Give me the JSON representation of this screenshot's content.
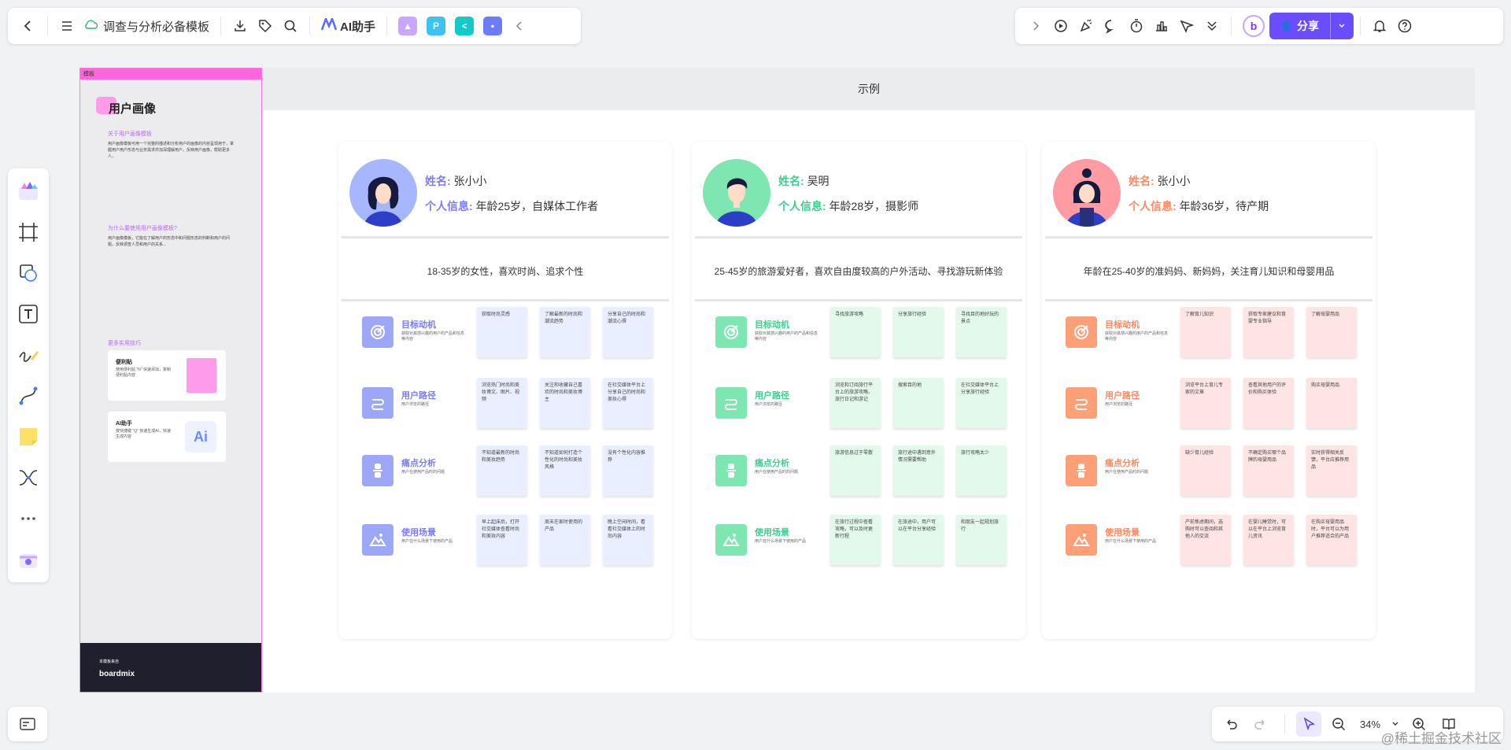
{
  "toolbar": {
    "doc_title": "调查与分析必备模板",
    "ai_label": "AI助手",
    "share_label": "分享",
    "zoom": "34%"
  },
  "template": {
    "header": "模板",
    "title": "用户画像",
    "sec1_head": "关于用户画像模板",
    "sec1_text": "用户画像模板可用一个完整的描述和分析用户的画像的内容呈现用于，掌握用户用户形态与业务需求并加深理解用户，反映用户画像，帮助更多人，",
    "sec2_head": "为什么要使用用户画像模板?",
    "sec2_text": "用户画像模板，它能在了解用户的形态中和问题形态的判断和用户的问题，反映调查人员和用户的关系...",
    "sec3_head": "更多实用技巧",
    "card1_title": "便利贴",
    "card1_text": "使用便利贴 \"N\" 快速添加，复制便利贴内容",
    "card2_title": "AI助手",
    "card2_text": "按快捷键 \"Q\" 快速生成AI，快速生成内容",
    "footer_small": "本模板来自",
    "footer_brand": "boardmix"
  },
  "main": {
    "header": "示例",
    "name_key": "姓名:",
    "info_key": "个人信息:",
    "personas": [
      {
        "name": "张小小",
        "info": "年龄25岁，自媒体工作者",
        "desc": "18-35岁的女性，喜欢时尚、追求个性",
        "accent": "#7b7cf6",
        "sticky": "#e9efff",
        "iconbg": "#9da7f8",
        "rows": [
          {
            "label": "目标动机",
            "sub": "获取对其感兴趣的用户的产品和信息等内容",
            "notes": [
              "获取时尚灵感",
              "了解最新的时尚和潮流趋势",
              "分享自己的时尚和潮流心得"
            ]
          },
          {
            "label": "用户路径",
            "sub": "用户浏览的路径",
            "notes": [
              "浏览热门时尚和美妆博文、图片、视频",
              "关注和收藏自己喜欢的时尚和美妆博主",
              "在社交媒体平台上分享自己的时尚和美妆心得"
            ]
          },
          {
            "label": "痛点分析",
            "sub": "用户在使用产品时的问题",
            "notes": [
              "不知道最新的时尚和美妆趋势",
              "不知道如何打造个性化的时尚和美妆风格",
              "没有个性化内容推荐"
            ]
          },
          {
            "label": "使用场景",
            "sub": "用户在什么场景下使用的产品",
            "notes": [
              "早上起床后，打开社交媒体查看时尚和美妆内容",
              "周末在家时使用的产品",
              "晚上空闲时间，看看社交媒体上的时尚内容"
            ]
          }
        ]
      },
      {
        "name": "吴明",
        "info": "年龄28岁，摄影师",
        "desc": "25-45岁的旅游爱好者，喜欢自由度较高的户外活动、寻找游玩新体验",
        "accent": "#3ecf8e",
        "sticky": "#e3f9ec",
        "iconbg": "#7ee6b1",
        "rows": [
          {
            "label": "目标动机",
            "sub": "获取对其感兴趣的用户的产品和信息等内容",
            "notes": [
              "寻找旅游攻略",
              "分享旅行经验",
              "寻找目的地好玩的景点"
            ]
          },
          {
            "label": "用户路径",
            "sub": "用户浏览的路径",
            "notes": [
              "浏览和订阅旅行平台上的旅游攻略、旅行日记和游记",
              "搜索目的地",
              "在社交媒体平台上分享旅行经验"
            ]
          },
          {
            "label": "痛点分析",
            "sub": "用户在使用产品时的问题",
            "notes": [
              "旅游信息过于零散",
              "旅行途中遇到意外情况需要帮助",
              "旅行攻略太少"
            ]
          },
          {
            "label": "使用场景",
            "sub": "用户在什么场景下使用的产品",
            "notes": [
              "在旅行过程中查看攻略，可以及时更新行程",
              "在旅途中，用户可以在平台分享经验",
              "和朋友一起规划旅行"
            ]
          }
        ]
      },
      {
        "name": "张小小",
        "info": "年龄36岁，待产期",
        "desc": "年龄在25-40岁的准妈妈、新妈妈，关注育儿知识和母婴用品",
        "accent": "#fd8a5e",
        "sticky": "#ffe4e4",
        "iconbg": "#fd9f77",
        "rows": [
          {
            "label": "目标动机",
            "sub": "获取对其感兴趣的用户的产品和信息等内容",
            "notes": [
              "了解育儿知识",
              "获取专家建议和育婴专业指导",
              "了解母婴用品"
            ]
          },
          {
            "label": "用户路径",
            "sub": "用户浏览的路径",
            "notes": [
              "浏览平台上育儿专家的文章",
              "查看其他用户的评价和购买体验",
              "购买母婴用品"
            ]
          },
          {
            "label": "痛点分析",
            "sub": "用户在使用产品时的问题",
            "notes": [
              "缺少育儿经验",
              "不确定购买哪个品牌的母婴用品",
              "实时获得相关反馈，平台应推荐用品"
            ]
          },
          {
            "label": "使用场景",
            "sub": "用户在什么场景下使用的产品",
            "notes": [
              "产前焦虑期间，选购时可以查阅和其他人的交流",
              "在婴儿睡觉时，可以在平台上浏览育儿资讯",
              "在购买母婴用品时，平台可以为用户推荐适合的产品"
            ]
          }
        ]
      }
    ]
  },
  "watermark": "@稀土掘金技术社区"
}
